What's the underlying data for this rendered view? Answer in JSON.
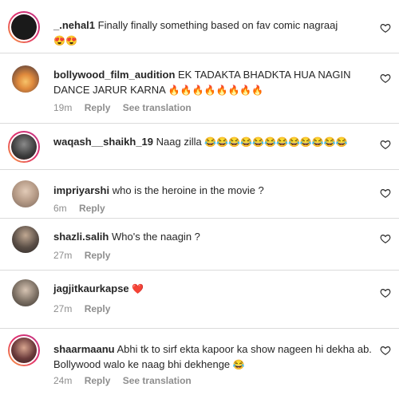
{
  "comments": [
    {
      "username": "_.nehal1",
      "text": "Finally finally something based on fav comic nagraaj",
      "emojis": "😍😍",
      "time": "",
      "reply": "",
      "see_translation": "",
      "avatar_color": "#1a1a1a"
    },
    {
      "username": "bollywood_film_audition",
      "text": "EK TADAKTA BHADKTA HUA NAGIN DANCE JARUR KARNA",
      "emojis": "🔥🔥🔥🔥🔥🔥🔥🔥",
      "time": "19m",
      "reply": "Reply",
      "see_translation": "See translation",
      "avatar_color": "#e08a3c"
    },
    {
      "username": "waqash__shaikh_19",
      "text": "Naag zilla",
      "emojis": "😂😂😂😂😂😂😂😂😂😂😂😂",
      "time": "",
      "reply": "",
      "see_translation": "",
      "avatar_color": "#3a3a3a"
    },
    {
      "username": "impriyarshi",
      "text": "who is the heroine in the movie ?",
      "emojis": "",
      "time": "6m",
      "reply": "Reply",
      "see_translation": "",
      "avatar_color": "#b59a86"
    },
    {
      "username": "shazli.salih",
      "text": "Who's the naagin ?",
      "emojis": "",
      "time": "27m",
      "reply": "Reply",
      "see_translation": "",
      "avatar_color": "#5a4e46"
    },
    {
      "username": "jagjitkaurkapse",
      "text": "",
      "emojis": "❤️",
      "time": "27m",
      "reply": "Reply",
      "see_translation": "",
      "avatar_color": "#7a6e62"
    },
    {
      "username": "shaarmaanu",
      "text": "Abhi tk to sirf ekta kapoor ka show nageen hi dekha ab. Bollywood walo ke naag bhi dekhenge",
      "emojis": "😂",
      "time": "24m",
      "reply": "Reply",
      "see_translation": "See translation",
      "avatar_color": "#6b3b3b"
    }
  ],
  "colors": {
    "text": "#262626",
    "meta": "#8e8e8e",
    "divider": "#dbdbdb",
    "heart_stroke": "#262626"
  }
}
